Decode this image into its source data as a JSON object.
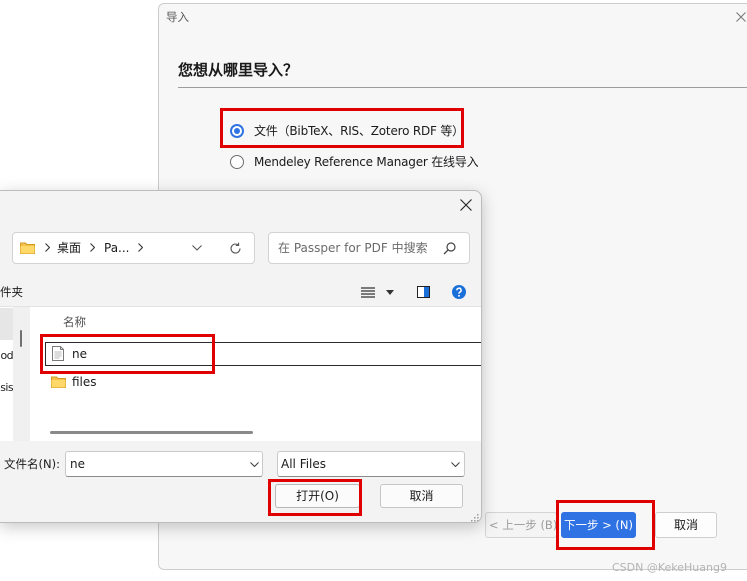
{
  "colors": {
    "accent": "#2f72e4",
    "help": "#1a6fd9",
    "highlight": "#e00000",
    "folder": "#f4c14d"
  },
  "import_dialog": {
    "title": "导入",
    "close_icon": "close-icon",
    "heading": "您想从哪里导入？",
    "options": [
      {
        "label": "文件（BibTeX、RIS、Zotero RDF 等）",
        "selected": true
      },
      {
        "label": "Mendeley Reference Manager 在线导入",
        "selected": false
      }
    ],
    "buttons": {
      "back": "< 上一步 (B)",
      "next": "下一步 > (N)",
      "cancel": "取消"
    }
  },
  "file_dialog": {
    "close_icon": "close-icon",
    "address": {
      "icon": "folder-icon",
      "path": [
        "桌面",
        "Pa..."
      ]
    },
    "search": {
      "placeholder": "在 Passper for PDF 中搜索",
      "icon": "search-icon"
    },
    "toolbar": {
      "new_folder_label": "件夹",
      "view_icon": "view-list-icon",
      "preview_icon": "preview-pane-icon",
      "help_icon": "help-icon"
    },
    "nav": {
      "items": [
        "od",
        "sis"
      ]
    },
    "list": {
      "column_name": "名称",
      "files": [
        {
          "name": "ne",
          "icon": "file-icon",
          "selected": true
        },
        {
          "name": "files",
          "icon": "folder-icon",
          "selected": false
        }
      ]
    },
    "filename": {
      "label": "文件名(N):",
      "value": "ne"
    },
    "filetype": {
      "value": "All Files"
    },
    "buttons": {
      "open": "打开(O)",
      "cancel": "取消"
    }
  },
  "watermark": "CSDN @KekeHuang9"
}
